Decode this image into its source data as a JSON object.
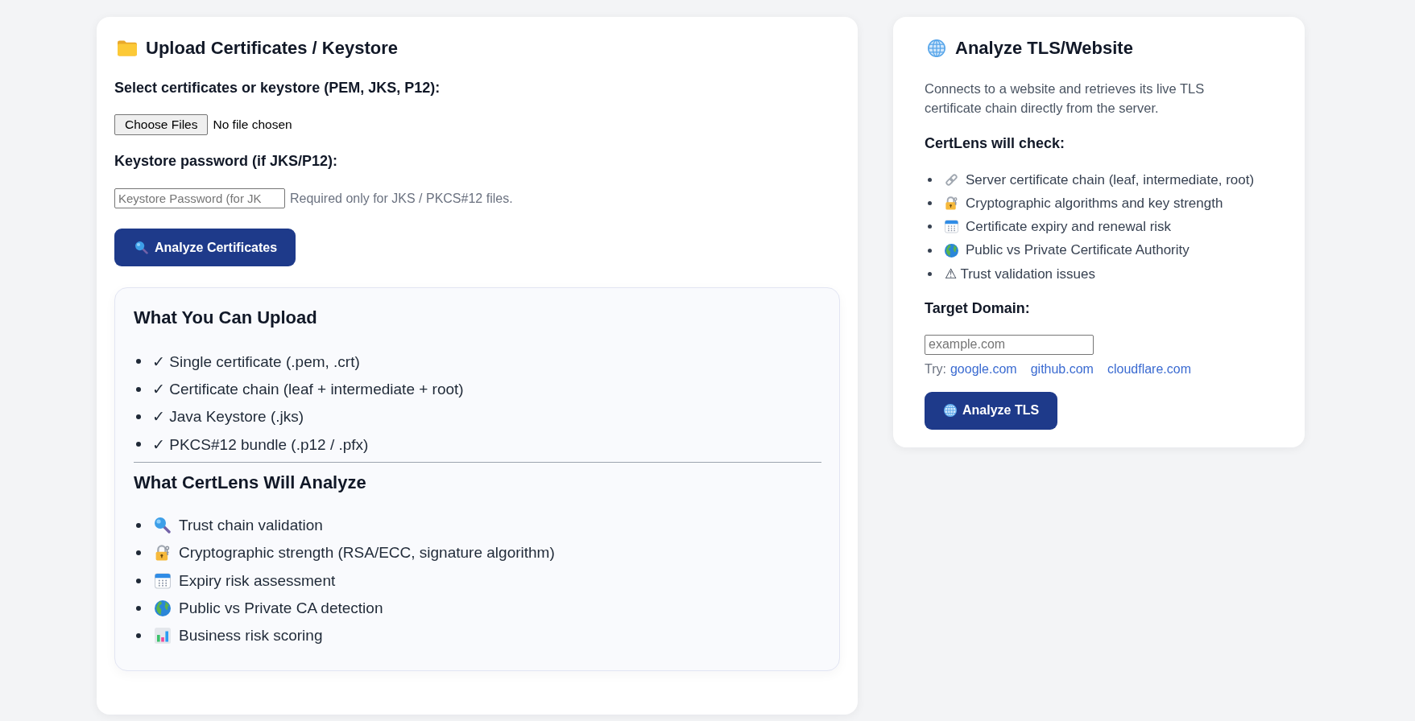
{
  "upload_panel": {
    "title": "Upload Certificates / Keystore",
    "file_label": "Select certificates or keystore (PEM, JKS, P12):",
    "file_picker": {
      "button": "Choose Files",
      "status": "No file chosen"
    },
    "password_label": "Keystore password (if JKS/P12):",
    "password_field": {
      "placeholder": "Keystore Password (for JK"
    },
    "password_hint": "Required only for JKS / PKCS#12 files.",
    "analyze_button": "Analyze Certificates",
    "info_sections": [
      {
        "heading": "What You Can Upload",
        "items": [
          {
            "text": "✓ Single certificate (.pem, .crt)"
          },
          {
            "text": "✓ Certificate chain (leaf + intermediate + root)"
          },
          {
            "text": "✓ Java Keystore (.jks)"
          },
          {
            "text": "✓ PKCS#12 bundle (.p12 / .pfx)"
          }
        ]
      },
      {
        "heading": "What CertLens Will Analyze",
        "items": [
          {
            "kind": "trust",
            "text": "Trust chain validation"
          },
          {
            "kind": "crypto",
            "text": "Cryptographic strength (RSA/ECC, signature algorithm)"
          },
          {
            "kind": "expiry",
            "text": "Expiry risk assessment"
          },
          {
            "kind": "authority",
            "text": "Public vs Private CA detection"
          },
          {
            "kind": "scoring",
            "text": "Business risk scoring"
          }
        ]
      }
    ]
  },
  "tls_panel": {
    "title": "Analyze TLS/Website",
    "description": "Connects to a website and retrieves its live TLS certificate chain directly from the server.",
    "checks_heading": "CertLens will check:",
    "checks": [
      {
        "kind": "chain",
        "text": "Server certificate chain (leaf, intermediate, root)"
      },
      {
        "kind": "crypto",
        "text": "Cryptographic algorithms and key strength"
      },
      {
        "kind": "expiry",
        "text": "Certificate expiry and renewal risk"
      },
      {
        "kind": "authority",
        "text": "Public vs Private Certificate Authority"
      },
      {
        "kind": "plain",
        "text": "⚠ Trust validation issues"
      }
    ],
    "domain_label": "Target Domain:",
    "domain_field": {
      "placeholder": "example.com"
    },
    "try_label": "Try:",
    "suggestions": [
      "google.com",
      "github.com",
      "cloudflare.com"
    ],
    "analyze_button": "Analyze TLS"
  }
}
